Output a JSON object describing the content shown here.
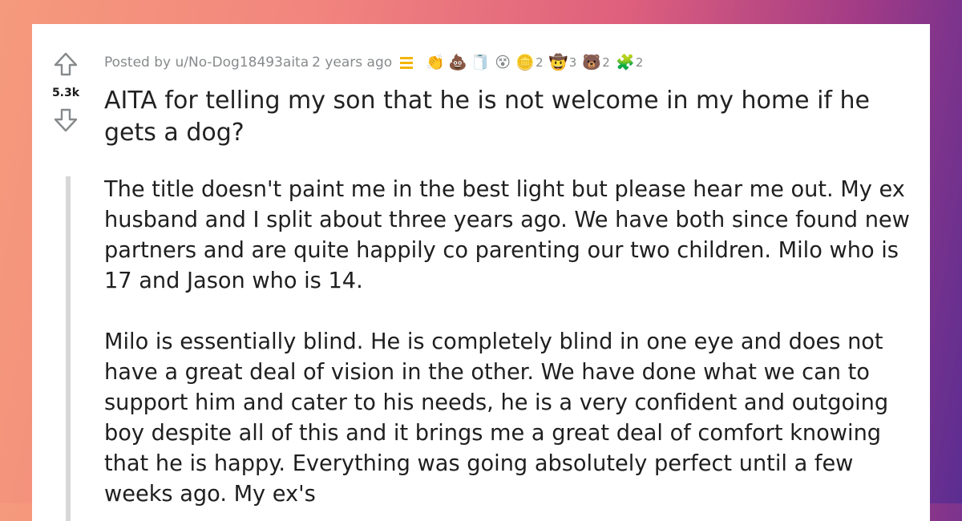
{
  "post": {
    "score": "5.3k",
    "posted_by": "Posted by u/No-Dog18493aita",
    "age": "2 years ago",
    "awards": [
      {
        "icon": "clapping-hands-icon",
        "glyph": "👏",
        "count": ""
      },
      {
        "icon": "poop-icon",
        "glyph": "💩",
        "count": ""
      },
      {
        "icon": "toilet-paper-icon",
        "glyph": "🧻",
        "count": ""
      },
      {
        "icon": "confused-face-icon",
        "glyph": "😵",
        "count": ""
      },
      {
        "icon": "silver-coin-icon",
        "glyph": "🪙",
        "count": "2"
      },
      {
        "icon": "hat-face-icon",
        "glyph": "🤠",
        "count": "3"
      },
      {
        "icon": "bear-icon",
        "glyph": "🐻",
        "count": "2"
      },
      {
        "icon": "puzzle-face-icon",
        "glyph": "🧩",
        "count": "2"
      }
    ],
    "title": "AITA for telling my son that he is not welcome in my home if he gets a dog?",
    "paragraphs": [
      "The title doesn't paint me in the best light but please hear me out. My ex husband and I split about three years ago. We have both since found new partners and are quite happily co parenting our two children. Milo who is 17 and Jason who is 14.",
      "Milo is essentially blind. He is completely blind in one eye and does not have a great deal of vision in the other. We have done what we can to support him and cater to his needs, he is a very confident and outgoing boy despite all of this and it brings me a great deal of comfort knowing that he is happy. Everything was going absolutely perfect until a few weeks ago. My ex's"
    ]
  },
  "colors": {
    "flair": "#f4b400",
    "meta_text": "#878a8c",
    "rule": "#d7d7d7"
  }
}
